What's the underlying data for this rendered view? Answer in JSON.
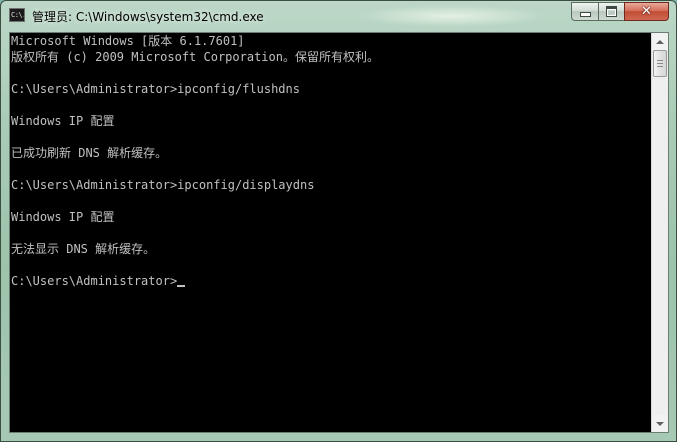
{
  "window": {
    "title": "管理员: C:\\Windows\\system32\\cmd.exe",
    "icon": "cmd-icon",
    "icon_text": "C:\\.",
    "buttons": {
      "minimize": "minimize-icon",
      "maximize": "maximize-icon",
      "close": "close-icon",
      "close_glyph": "✕"
    }
  },
  "console": {
    "lines": [
      "Microsoft Windows [版本 6.1.7601]",
      "版权所有 (c) 2009 Microsoft Corporation。保留所有权利。",
      "",
      "C:\\Users\\Administrator>ipconfig/flushdns",
      "",
      "Windows IP 配置",
      "",
      "已成功刷新 DNS 解析缓存。",
      "",
      "C:\\Users\\Administrator>ipconfig/displaydns",
      "",
      "Windows IP 配置",
      "",
      "无法显示 DNS 解析缓存。",
      "",
      "C:\\Users\\Administrator>"
    ]
  },
  "colors": {
    "console_background": "#000000",
    "console_text": "#c0c0c0",
    "close_button": "#c94f38"
  }
}
